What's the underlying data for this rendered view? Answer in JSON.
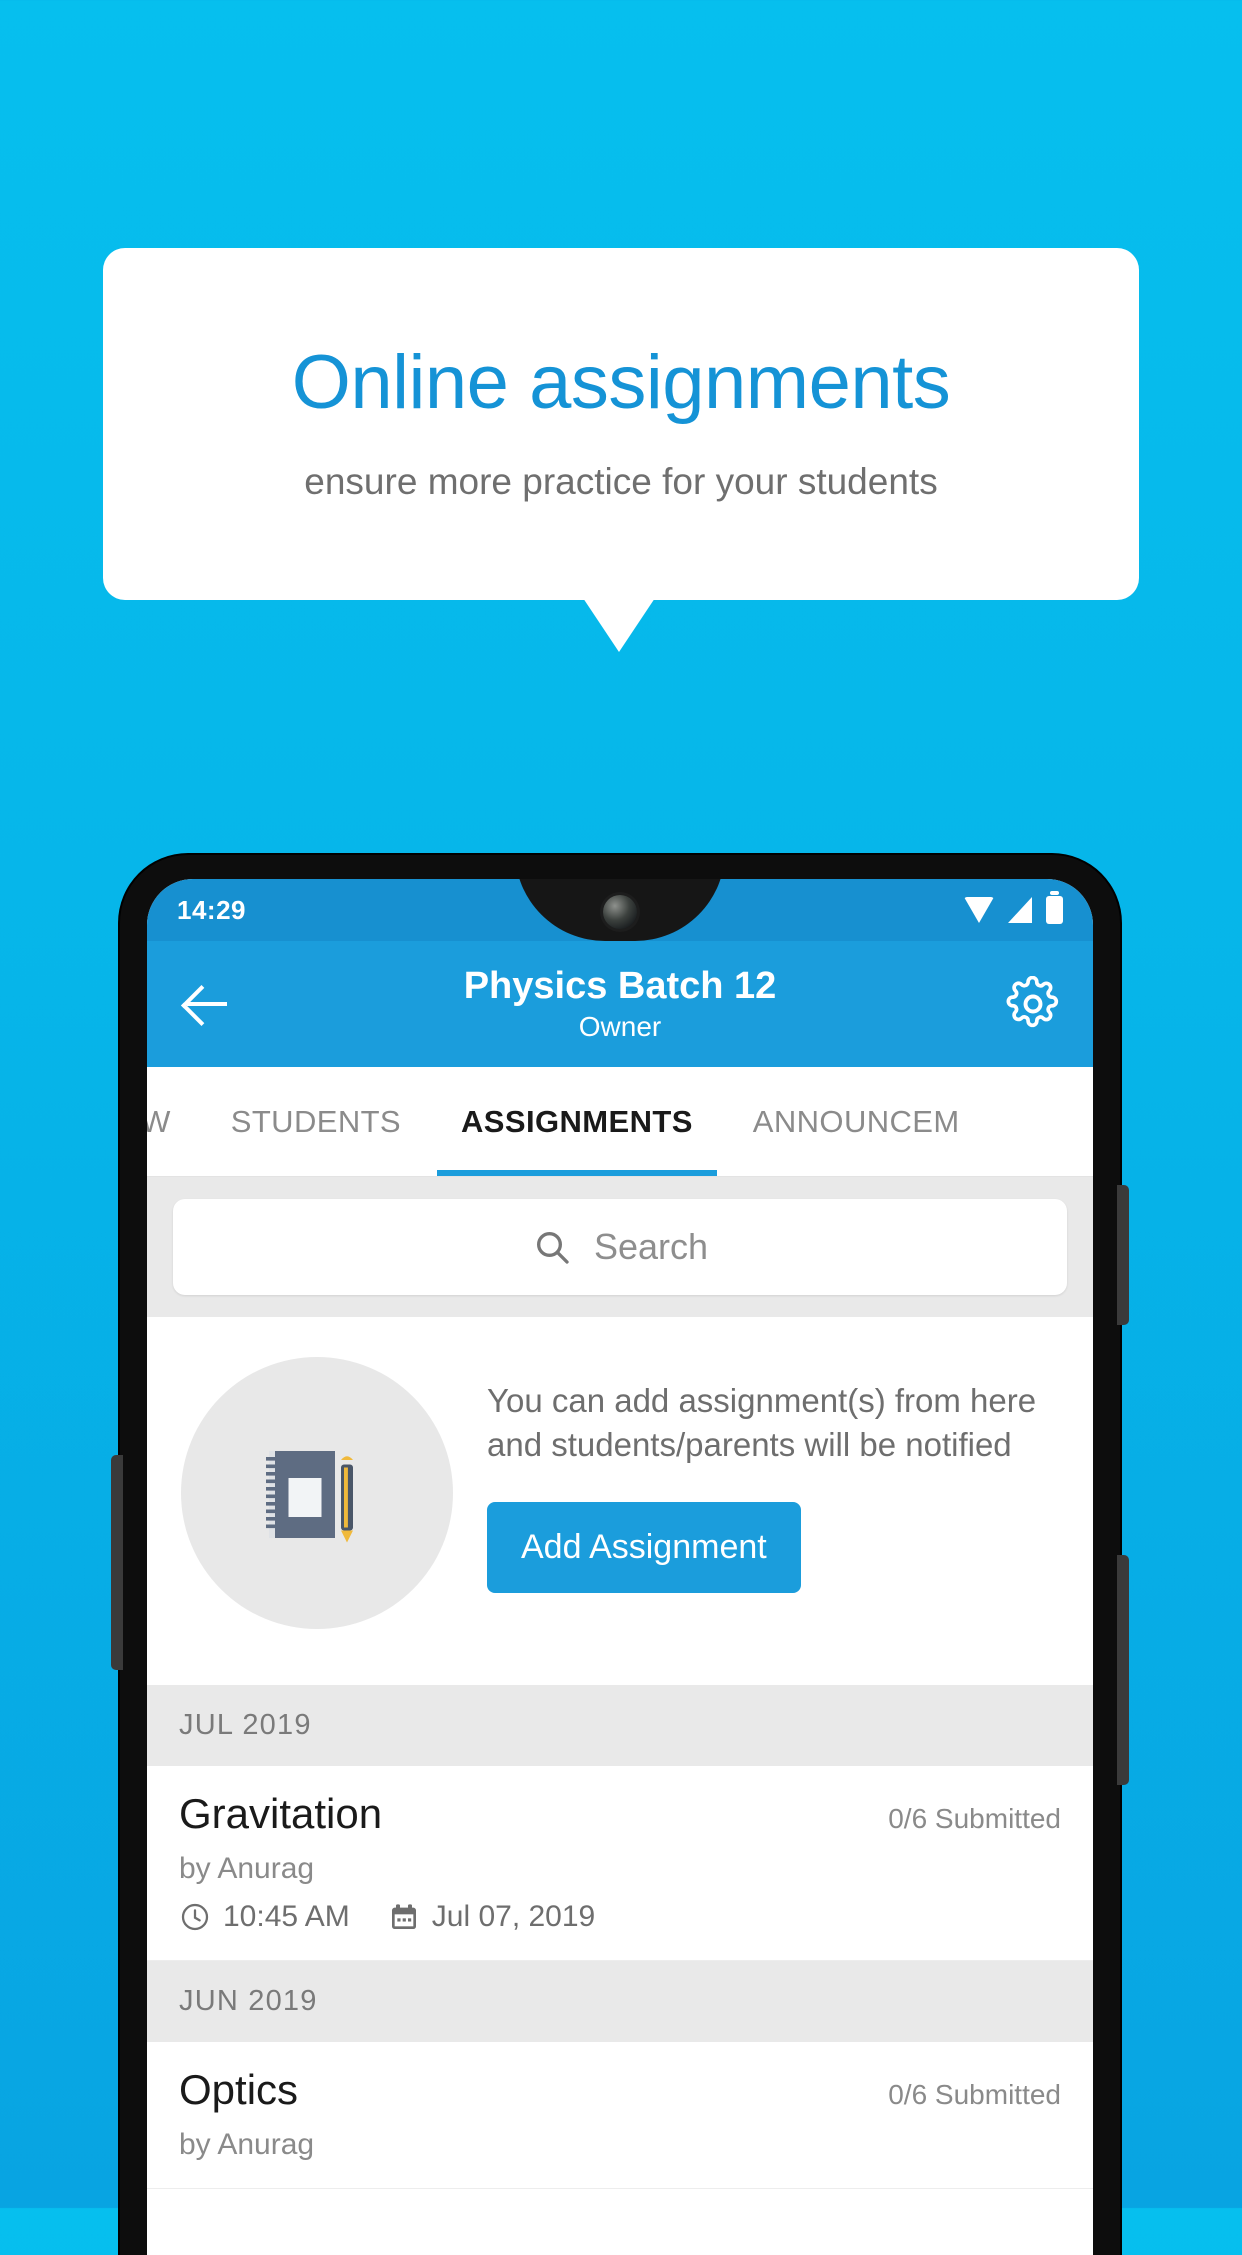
{
  "promo": {
    "title": "Online assignments",
    "subtitle": "ensure more practice for your students",
    "title_color": "#1593D6",
    "subtitle_color": "#6f6f6f",
    "background_color": "#06BFEE"
  },
  "statusbar": {
    "time": "14:29",
    "icons": [
      "wifi-icon",
      "signal-icon",
      "battery-icon"
    ]
  },
  "appbar": {
    "back_icon": "back-arrow-icon",
    "title": "Physics Batch 12",
    "subtitle": "Owner",
    "settings_icon": "gear-icon",
    "color": "#1B9DDC"
  },
  "tabs": [
    {
      "label": "IEW",
      "active": false
    },
    {
      "label": "STUDENTS",
      "active": false
    },
    {
      "label": "ASSIGNMENTS",
      "active": true
    },
    {
      "label": "ANNOUNCEM",
      "active": false
    }
  ],
  "search": {
    "placeholder": "Search",
    "value": "",
    "icon": "search-icon"
  },
  "empty_state": {
    "illustration": "notebook-pen-icon",
    "message": "You can add assignment(s) from here and students/parents will be notified",
    "button_label": "Add Assignment",
    "button_color": "#1B9DDC"
  },
  "sections": [
    {
      "month": "JUL 2019",
      "items": [
        {
          "title": "Gravitation",
          "submitted": "0/6 Submitted",
          "author": "by Anurag",
          "time": "10:45 AM",
          "date": "Jul 07, 2019",
          "time_icon": "clock-icon",
          "date_icon": "calendar-icon"
        }
      ]
    },
    {
      "month": "JUN 2019",
      "items": [
        {
          "title": "Optics",
          "submitted": "0/6 Submitted",
          "author": "by Anurag",
          "time": "",
          "date": "",
          "time_icon": "clock-icon",
          "date_icon": "calendar-icon"
        }
      ]
    }
  ]
}
